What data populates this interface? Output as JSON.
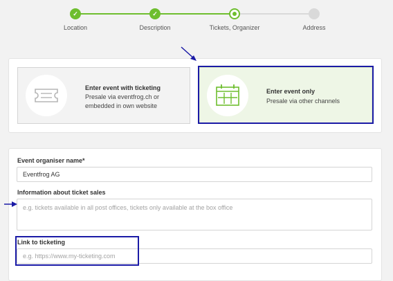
{
  "stepper": {
    "steps": [
      {
        "label": "Location",
        "state": "done"
      },
      {
        "label": "Description",
        "state": "done"
      },
      {
        "label": "Tickets, Organizer",
        "state": "current"
      },
      {
        "label": "Address",
        "state": "todo"
      }
    ],
    "check_glyph": "✓"
  },
  "options": {
    "with_ticketing": {
      "title": "Enter event with ticketing",
      "description": "Presale via eventfrog.ch or embedded in own website",
      "icon": "ticket-icon"
    },
    "event_only": {
      "title": "Enter event only",
      "description": "Presale via other channels",
      "icon": "calendar-icon"
    }
  },
  "form": {
    "organiser_label": "Event organiser name*",
    "organiser_value": "Eventfrog AG",
    "ticket_sales_label": "Information about ticket sales",
    "ticket_sales_placeholder": "e.g. tickets available in all post offices, tickets only available at the box office",
    "link_label": "Link to ticketing",
    "link_placeholder": "e.g. https://www.my-ticketing.com"
  },
  "colors": {
    "accent_green": "#6ebe2e",
    "annotation_blue": "#1a1aa6",
    "selected_bg": "#eef6e6"
  }
}
